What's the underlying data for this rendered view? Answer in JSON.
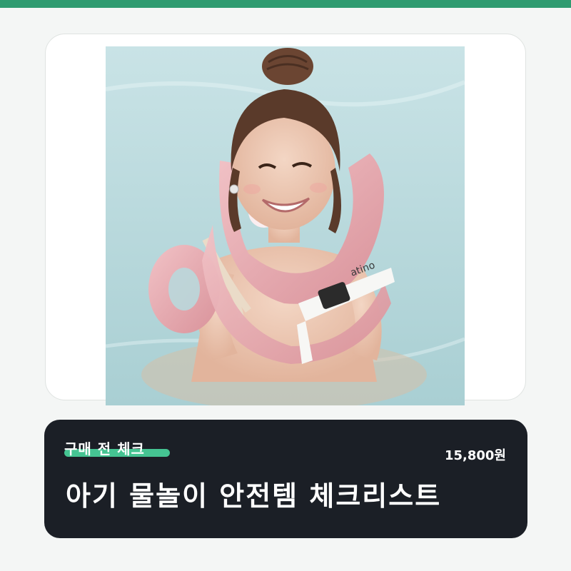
{
  "colors": {
    "top_bar": "#2f9b70",
    "page_background": "#f4f6f5",
    "card_background": "#1b1f26",
    "tag_highlight": "#45c492",
    "text": "#ffffff"
  },
  "photo": {
    "logo_text": "atino"
  },
  "info": {
    "tag": "구매 전 체크",
    "price": "15,800원",
    "title": "아기 물놀이 안전템 체크리스트"
  }
}
